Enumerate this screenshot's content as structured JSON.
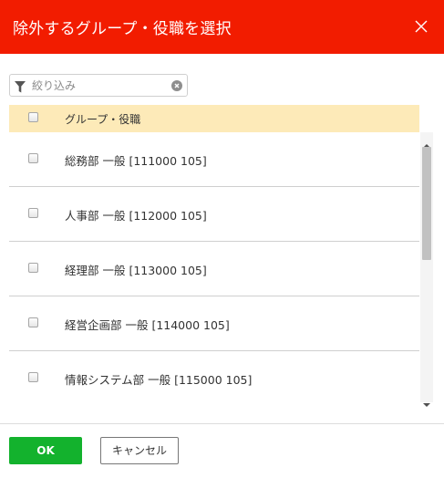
{
  "dialog": {
    "title": "除外するグループ・役職を選択",
    "close_icon": "close-icon"
  },
  "filter": {
    "placeholder": "絞り込み",
    "value": "",
    "icon": "funnel-icon",
    "clear_icon": "clear-icon"
  },
  "table": {
    "header_label": "グループ・役職",
    "header_checked": false,
    "rows": [
      {
        "label": "総務部 一般 [111000 105]",
        "checked": false
      },
      {
        "label": "人事部 一般 [112000 105]",
        "checked": false
      },
      {
        "label": "経理部 一般 [113000 105]",
        "checked": false
      },
      {
        "label": "経営企画部 一般 [114000 105]",
        "checked": false
      },
      {
        "label": "情報システム部 一般 [115000 105]",
        "checked": false
      }
    ]
  },
  "buttons": {
    "ok_label": "OK",
    "cancel_label": "キャンセル"
  },
  "colors": {
    "header_bg": "#f21c00",
    "table_header_bg": "#fdeab8",
    "ok_bg": "#13b22d"
  }
}
